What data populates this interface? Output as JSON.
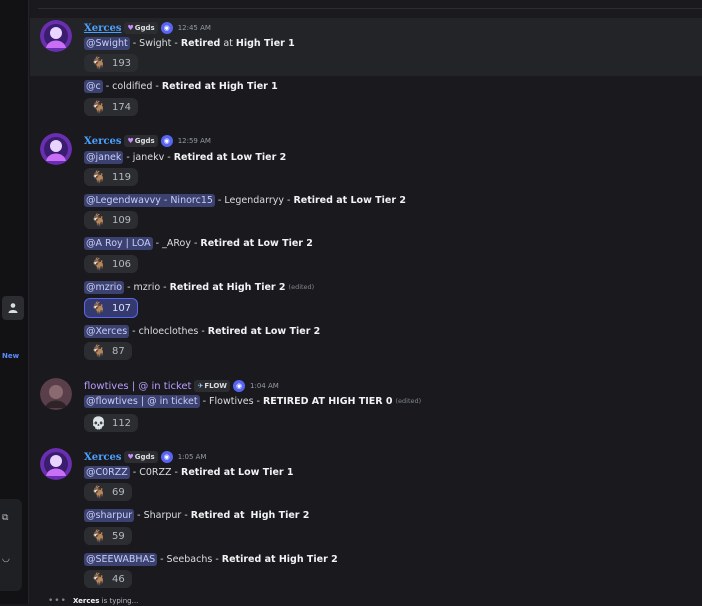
{
  "rail": {
    "new_label": "New"
  },
  "messages": [
    {
      "author": "Xerces",
      "tag": "Ggds",
      "time": "12:45 AM",
      "lines": [
        {
          "mention": "@Swight",
          "text": " - Swight - ",
          "bold1": "Retired",
          "mid": " at ",
          "bold2": "High Tier 1",
          "reaction": "193"
        },
        {
          "mention": "@c",
          "text": " - coldified - ",
          "bold1": "Retired at High Tier 1",
          "reaction": "174"
        }
      ]
    },
    {
      "author": "Xerces",
      "tag": "Ggds",
      "time": "12:59 AM",
      "lines": [
        {
          "mention": "@janek",
          "text": " - janekv - ",
          "bold1": "Retired at Low Tier 2",
          "reaction": "119"
        },
        {
          "mention": "@Legendwavvy - Ninorc15",
          "text": " - Legendarryy - ",
          "bold1": "Retired at Low Tier 2",
          "reaction": "109"
        },
        {
          "mention": "@A Roy | LOA",
          "text": " - _ARoy - ",
          "bold1": "Retired at Low Tier 2",
          "reaction": "106"
        },
        {
          "mention": "@mzrio",
          "text": " - mzrio - ",
          "bold1": "Retired at High Tier 2",
          "edited": "(edited)",
          "reaction": "107"
        },
        {
          "mention": "@Xerces",
          "text": " - chloeclothes - ",
          "bold1": "Retired at Low Tier 2",
          "reaction": "87"
        }
      ]
    },
    {
      "author": "flowtives | @ in ticket",
      "tag": "FLOW",
      "time": "1:04 AM",
      "lines": [
        {
          "mention": "@flowtives | @ in ticket",
          "text": " - Flowtives - ",
          "bold1": "RETIRED AT HIGH TIER 0",
          "edited": "(edited)",
          "reaction": "112"
        }
      ]
    },
    {
      "author": "Xerces",
      "tag": "Ggds",
      "time": "1:05 AM",
      "lines": [
        {
          "mention": "@C0RZZ",
          "text": " - C0RZZ - ",
          "bold1": "Retired at Low Tier 1",
          "reaction": "69"
        },
        {
          "mention": "@sharpur",
          "text": " - Sharpur - ",
          "bold1": "Retired at",
          "mid": " ",
          "bold2": "High Tier 2",
          "reaction": "59"
        },
        {
          "mention": "@SEEWABHAS",
          "text": " - Seebachs - ",
          "bold1": "Retired at High Tier 2",
          "reaction": "46"
        }
      ]
    }
  ],
  "typing": {
    "user": "Xerces",
    "text": " is typing..."
  },
  "colors": {
    "mention_bg": "#3c4270",
    "author": "#4aa0ff",
    "accent": "#5865f2",
    "background": "#1a1a1e"
  },
  "icons": {
    "reaction_emoji": "goat-emoji",
    "skull_emoji": "skull-emoji"
  }
}
